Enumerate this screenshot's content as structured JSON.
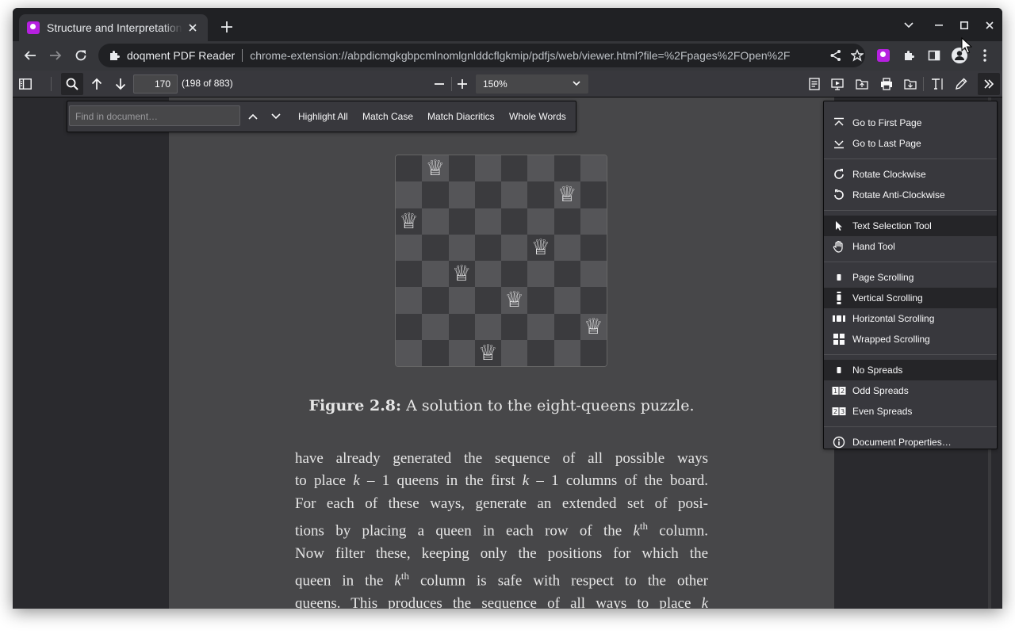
{
  "browser": {
    "tab": {
      "title": "Structure and Interpretation of Computer Programs"
    },
    "omnibox": {
      "site_name": "doqment PDF Reader",
      "url": "chrome-extension://abpdicmgkgbpcmlnomlgnlddcflgkmip/pdfjs/web/viewer.html?file=%2Fpages%2FOpen%2F"
    },
    "accent_color": "#b620e0"
  },
  "pdf_toolbar": {
    "page_number": "170",
    "page_count": "(198 of 883)",
    "zoom": "150%"
  },
  "find_bar": {
    "placeholder": "Find in document…",
    "options": [
      "Highlight All",
      "Match Case",
      "Match Diacritics",
      "Whole Words"
    ]
  },
  "menu": {
    "groups": [
      [
        {
          "label": "Go to First Page",
          "icon": "first-page-icon"
        },
        {
          "label": "Go to Last Page",
          "icon": "last-page-icon"
        }
      ],
      [
        {
          "label": "Rotate Clockwise",
          "icon": "rotate-cw-icon"
        },
        {
          "label": "Rotate Anti-Clockwise",
          "icon": "rotate-ccw-icon"
        }
      ],
      [
        {
          "label": "Text Selection Tool",
          "icon": "cursor-icon",
          "selected": true
        },
        {
          "label": "Hand Tool",
          "icon": "hand-icon"
        }
      ],
      [
        {
          "label": "Page Scrolling",
          "icon": "page-scroll-icon"
        },
        {
          "label": "Vertical Scrolling",
          "icon": "vertical-scroll-icon",
          "selected": true
        },
        {
          "label": "Horizontal Scrolling",
          "icon": "horizontal-scroll-icon"
        },
        {
          "label": "Wrapped Scrolling",
          "icon": "wrapped-scroll-icon"
        }
      ],
      [
        {
          "label": "No Spreads",
          "icon": "no-spreads-icon",
          "selected": true
        },
        {
          "label": "Odd Spreads",
          "icon": "odd-spreads-icon"
        },
        {
          "label": "Even Spreads",
          "icon": "even-spreads-icon"
        }
      ],
      [
        {
          "label": "Document Properties…",
          "icon": "info-icon"
        }
      ]
    ]
  },
  "document": {
    "queens_columns": [
      2,
      0,
      4,
      7,
      5,
      3,
      1,
      6
    ],
    "figure_label": "Figure 2.8:",
    "figure_caption": " A solution to the eight-queens puzzle.",
    "body_lines": [
      "have already generated the sequence of all possible ways",
      "to place k – 1 queens in the first k – 1 columns of the board.",
      "For each of these ways, generate an extended set of posi-",
      "tions by placing a queen in each row of the kth column.",
      "Now filter these, keeping only the positions for which the",
      "queen in the kth column is safe with respect to the other",
      "queens. This produces the sequence of all ways to place k"
    ]
  }
}
